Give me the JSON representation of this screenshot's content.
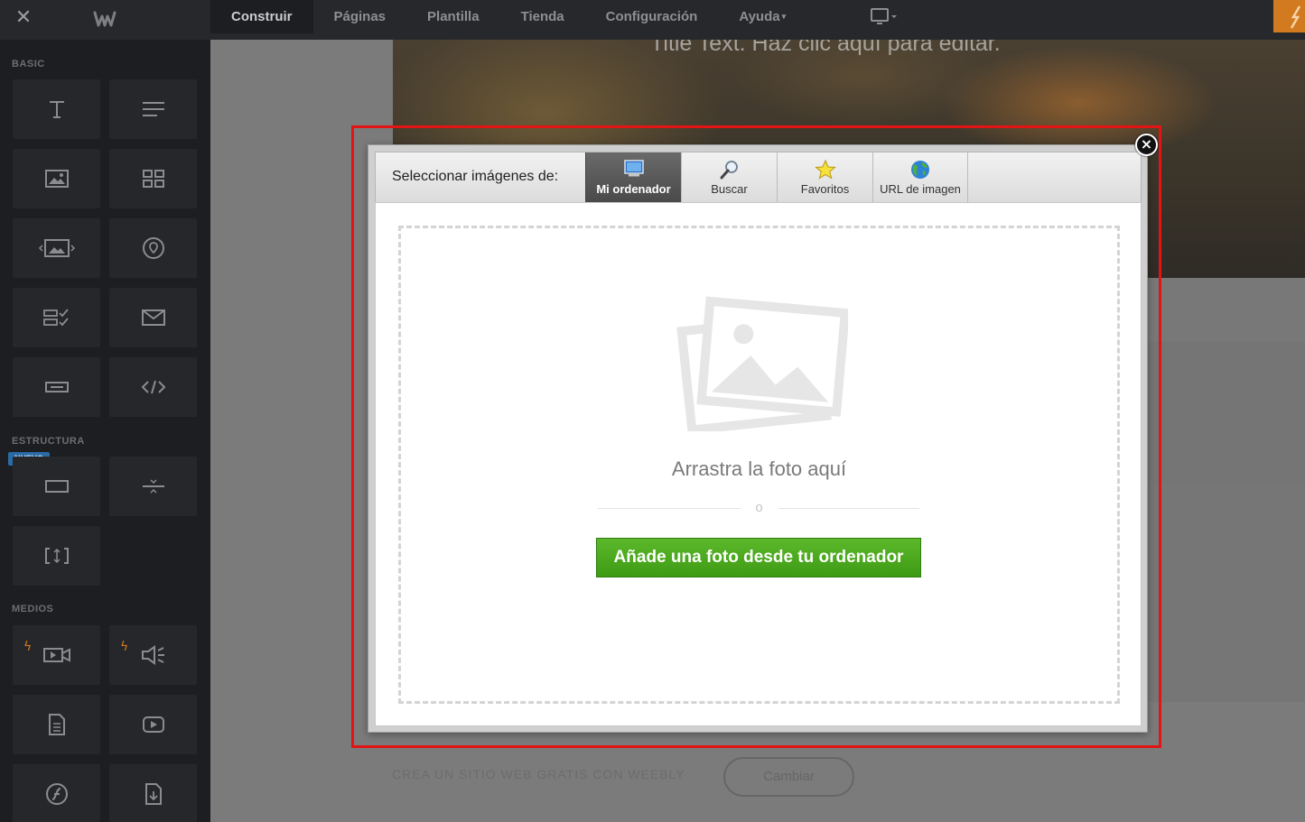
{
  "topbar": {
    "nav": [
      {
        "label": "Construir",
        "active": true
      },
      {
        "label": "Páginas"
      },
      {
        "label": "Plantilla"
      },
      {
        "label": "Tienda"
      },
      {
        "label": "Configuración"
      },
      {
        "label": "Ayuda",
        "dropdown": true
      }
    ],
    "caret": "▾",
    "icons": [
      "close-icon",
      "weebly-logo-icon",
      "device-monitor-icon",
      "lightning-icon"
    ],
    "accent_color": "#d27a1f"
  },
  "sidebar": {
    "sections": {
      "basic": "BASIC",
      "structure": "ESTRUCTURA",
      "media": "MEDIOS"
    },
    "new_badge": "NUEVO",
    "tools": [
      "text-icon",
      "paragraph-icon",
      "image-icon",
      "gallery-icon",
      "slideshow-icon",
      "map-icon",
      "form-icon",
      "contact-form-icon",
      "button-icon",
      "embed-code-icon",
      "section-icon",
      "divider-icon",
      "spacer-icon",
      "video-icon",
      "audio-icon",
      "document-icon",
      "youtube-icon",
      "flash-icon",
      "file-icon"
    ]
  },
  "canvas": {
    "hero_text": "Title Text. Haz clic aquí para editar.",
    "footer_text": "CREA UN SITIO WEB GRATIS CON WEEBLY",
    "footer_button": "Cambiar"
  },
  "dialog": {
    "select_from_label": "Seleccionar imágenes de:",
    "tabs": [
      {
        "label": "Mi ordenador",
        "icon": "computer-icon",
        "active": true
      },
      {
        "label": "Buscar",
        "icon": "magnifier-icon"
      },
      {
        "label": "Favoritos",
        "icon": "star-icon"
      },
      {
        "label": "URL de imagen",
        "icon": "globe-icon"
      }
    ],
    "drop_text": "Arrastra la foto aquí",
    "or_text": "o",
    "upload_button": "Añade una foto desde tu ordenador",
    "close_glyph": "×",
    "upload_button_color": "#4aa81c",
    "highlight_color": "#e21414"
  }
}
